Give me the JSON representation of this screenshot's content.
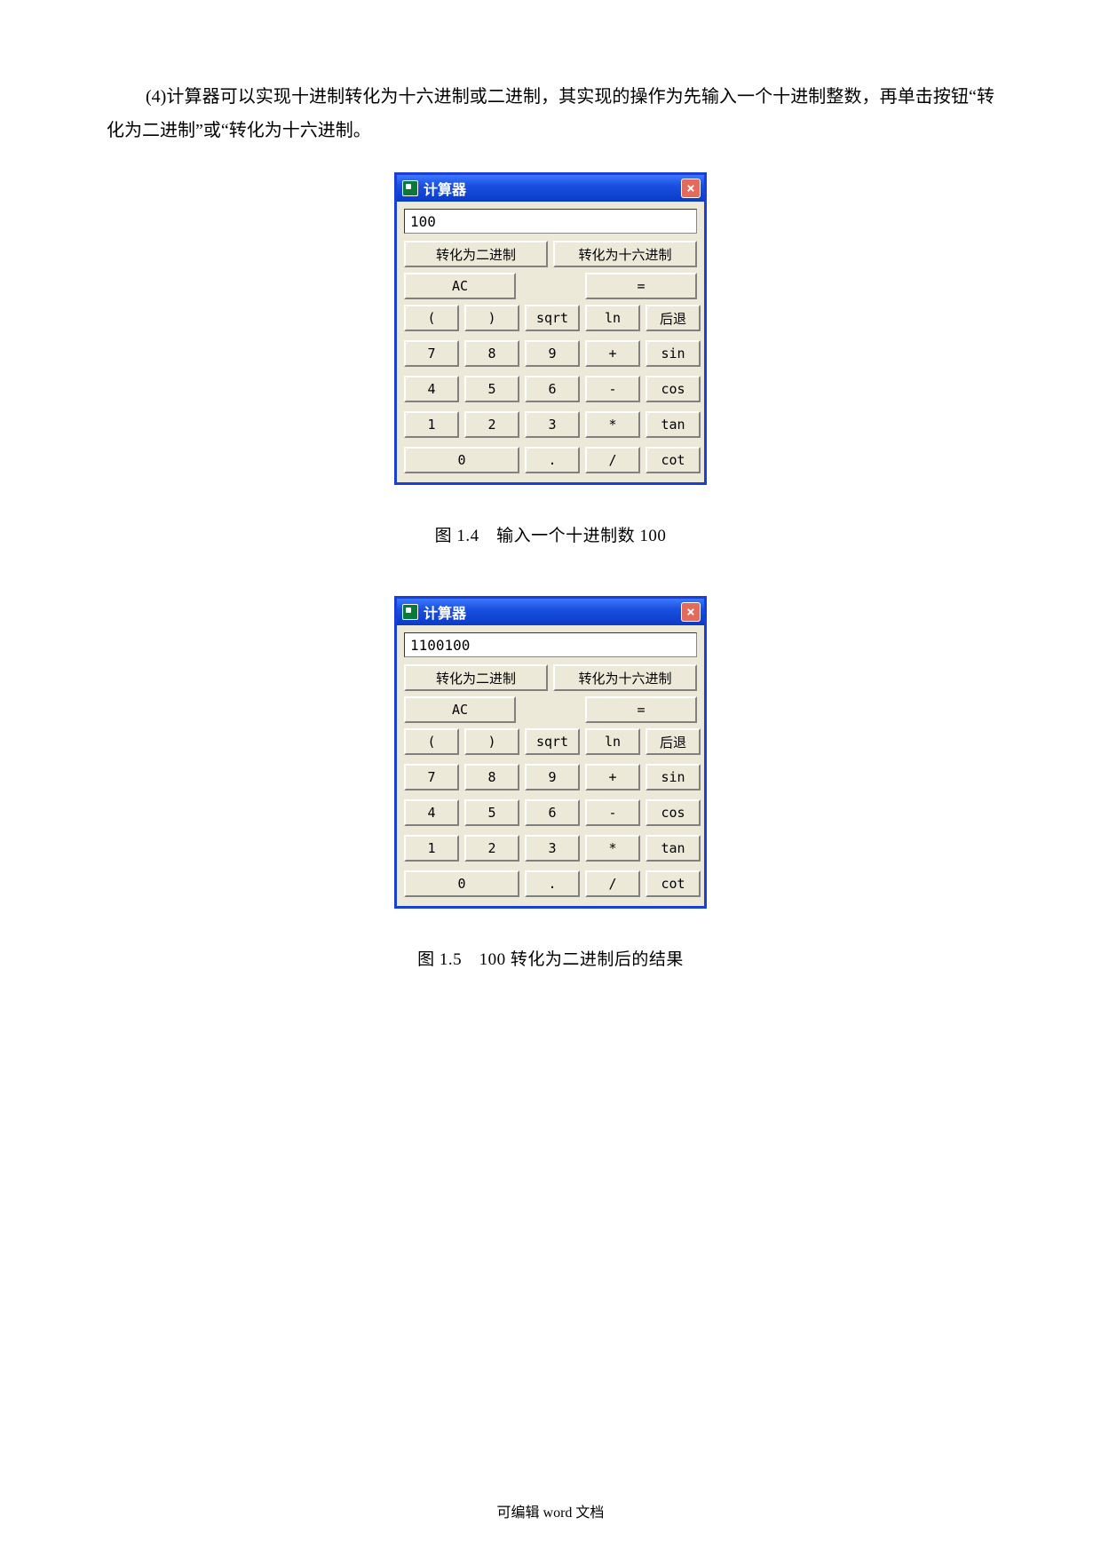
{
  "paragraph": "(4)计算器可以实现十进制转化为十六进制或二进制，其实现的操作为先输入一个十进制整数，再单击按钮“转化为二进制”或“转化为十六进制。",
  "footer": "可编辑 word 文档",
  "fig1": {
    "title": "计算器",
    "close": "×",
    "display": "100",
    "to_bin": "转化为二进制",
    "to_hex": "转化为十六进制",
    "ac": "AC",
    "eq": "=",
    "b_lparen": "(",
    "b_rparen": ")",
    "b_sqrt": "sqrt",
    "b_ln": "ln",
    "b_back": "后退",
    "b7": "7",
    "b8": "8",
    "b9": "9",
    "b_plus": "+",
    "b_sin": "sin",
    "b4": "4",
    "b5": "5",
    "b6": "6",
    "b_minus": "-",
    "b_cos": "cos",
    "b1": "1",
    "b2": "2",
    "b3": "3",
    "b_mul": "*",
    "b_tan": "tan",
    "b0": "0",
    "b_dot": ".",
    "b_div": "/",
    "b_cot": "cot",
    "caption": "图 1.4　输入一个十进制数 100"
  },
  "fig2": {
    "title": "计算器",
    "close": "×",
    "display": "1100100",
    "to_bin": "转化为二进制",
    "to_hex": "转化为十六进制",
    "ac": "AC",
    "eq": "=",
    "b_lparen": "(",
    "b_rparen": ")",
    "b_sqrt": "sqrt",
    "b_ln": "ln",
    "b_back": "后退",
    "b7": "7",
    "b8": "8",
    "b9": "9",
    "b_plus": "+",
    "b_sin": "sin",
    "b4": "4",
    "b5": "5",
    "b6": "6",
    "b_minus": "-",
    "b_cos": "cos",
    "b1": "1",
    "b2": "2",
    "b3": "3",
    "b_mul": "*",
    "b_tan": "tan",
    "b0": "0",
    "b_dot": ".",
    "b_div": "/",
    "b_cot": "cot",
    "caption": "图 1.5　100 转化为二进制后的结果"
  }
}
